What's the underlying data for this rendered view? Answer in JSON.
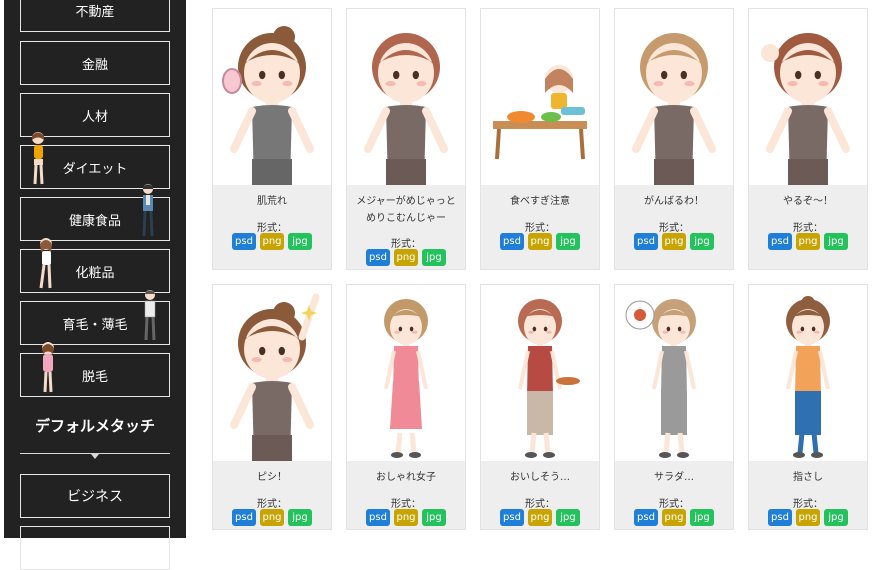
{
  "sidebar": {
    "categories": [
      "不動産",
      "金融",
      "人材",
      "ダイエット",
      "健康食品",
      "化粧品",
      "育毛・薄毛",
      "脱毛"
    ],
    "section_title": "デフォルメタッチ",
    "section_items": [
      "ビジネス"
    ]
  },
  "colors": {
    "psd": "#1f7fd8",
    "png": "#c8a400",
    "jpg": "#23c25c",
    "sidebar": "#222222"
  },
  "format_label": "形式：",
  "tags": [
    "psd",
    "png",
    "jpg"
  ],
  "cards": [
    {
      "title": "肌荒れ",
      "icon": "girl-bun-mirror-icon"
    },
    {
      "title": "メジャーがめじゃっと\nめりこむんじゃー",
      "icon": "girl-measuring-waist-icon"
    },
    {
      "title": "食べすぎ注意",
      "icon": "girl-eating-table-icon"
    },
    {
      "title": "がんばるわ！",
      "icon": "girl-long-hair-fists-icon"
    },
    {
      "title": "やるぞ～！",
      "icon": "girl-bob-fist-up-icon"
    },
    {
      "title": "ピシ！",
      "icon": "girl-bun-pointing-icon"
    },
    {
      "title": "おしゃれ女子",
      "icon": "girl-pink-dress-icon"
    },
    {
      "title": "おいしそう…",
      "icon": "girl-holding-food-icon"
    },
    {
      "title": "サラダ…",
      "icon": "girl-suit-thinking-icon"
    },
    {
      "title": "指さし",
      "icon": "girl-orange-top-pointing-icon"
    }
  ]
}
